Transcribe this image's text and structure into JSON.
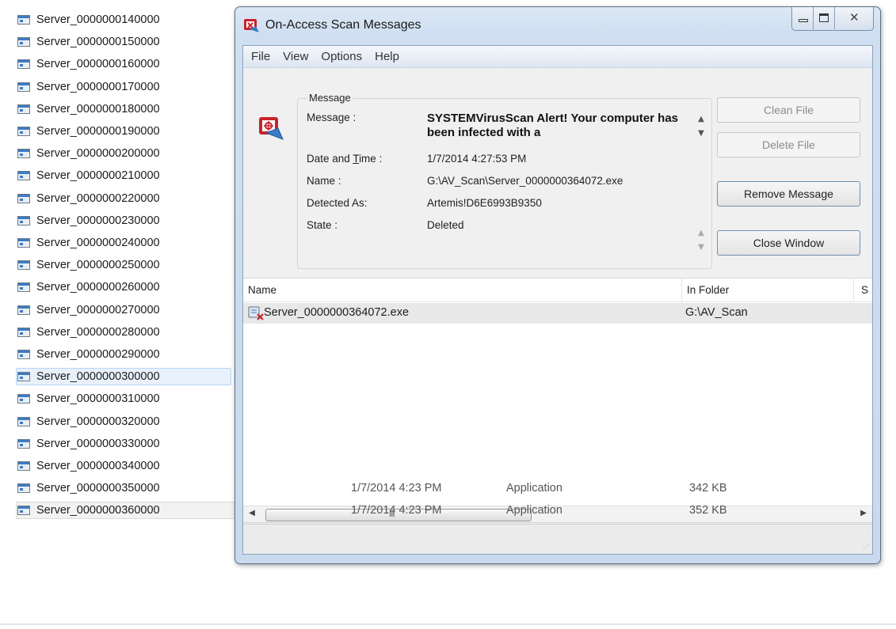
{
  "explorer": {
    "files": [
      {
        "name": "Server_0000000140000"
      },
      {
        "name": "Server_0000000150000"
      },
      {
        "name": "Server_0000000160000"
      },
      {
        "name": "Server_0000000170000"
      },
      {
        "name": "Server_0000000180000"
      },
      {
        "name": "Server_0000000190000"
      },
      {
        "name": "Server_0000000200000"
      },
      {
        "name": "Server_0000000210000"
      },
      {
        "name": "Server_0000000220000"
      },
      {
        "name": "Server_0000000230000"
      },
      {
        "name": "Server_0000000240000"
      },
      {
        "name": "Server_0000000250000"
      },
      {
        "name": "Server_0000000260000"
      },
      {
        "name": "Server_0000000270000"
      },
      {
        "name": "Server_0000000280000"
      },
      {
        "name": "Server_0000000290000"
      },
      {
        "name": "Server_0000000300000",
        "selected": true
      },
      {
        "name": "Server_0000000310000"
      },
      {
        "name": "Server_0000000320000"
      },
      {
        "name": "Server_0000000330000"
      },
      {
        "name": "Server_0000000340000"
      },
      {
        "name": "Server_0000000350000",
        "date": "1/7/2014 4:23 PM",
        "type": "Application",
        "size": "342 KB"
      },
      {
        "name": "Server_0000000360000",
        "date": "1/7/2014 4:23 PM",
        "type": "Application",
        "size": "352 KB",
        "last": true
      }
    ]
  },
  "dialog": {
    "title": "On-Access Scan Messages",
    "title_icon": "virusscan-shield-icon",
    "caption_buttons": {
      "minimize": "minimize-icon",
      "maximize": "maximize-icon",
      "close": "close-icon"
    },
    "menu": [
      "File",
      "View",
      "Options",
      "Help"
    ],
    "group_label": "Message",
    "labels": {
      "message": "Message :",
      "date_time_prefix": "Date and ",
      "date_time_u": "T",
      "date_time_suffix": "ime :",
      "name": "Name :",
      "detected_as": "Detected As:",
      "state": "State :"
    },
    "values": {
      "message": "SYSTEMVirusScan Alert! Your computer has been infected with a",
      "date_time": "1/7/2014 4:27:53 PM",
      "name": "G:\\AV_Scan\\Server_0000000364072.exe",
      "detected_as": "Artemis!D6E6993B9350",
      "state": "Deleted"
    },
    "buttons": {
      "clean_file": "Clean File",
      "delete_file": "Delete File",
      "remove_message": "Remove Message",
      "close_window": "Close Window"
    },
    "list": {
      "columns": [
        "Name",
        "In Folder",
        "S"
      ],
      "rows": [
        {
          "name": "Server_0000000364072.exe",
          "folder": "G:\\AV_Scan"
        }
      ]
    },
    "scroll_glyph": "III",
    "colors": {
      "titlebar": "#cfdff1",
      "accent": "#3d7bc4",
      "alert_red": "#c8232c"
    }
  }
}
